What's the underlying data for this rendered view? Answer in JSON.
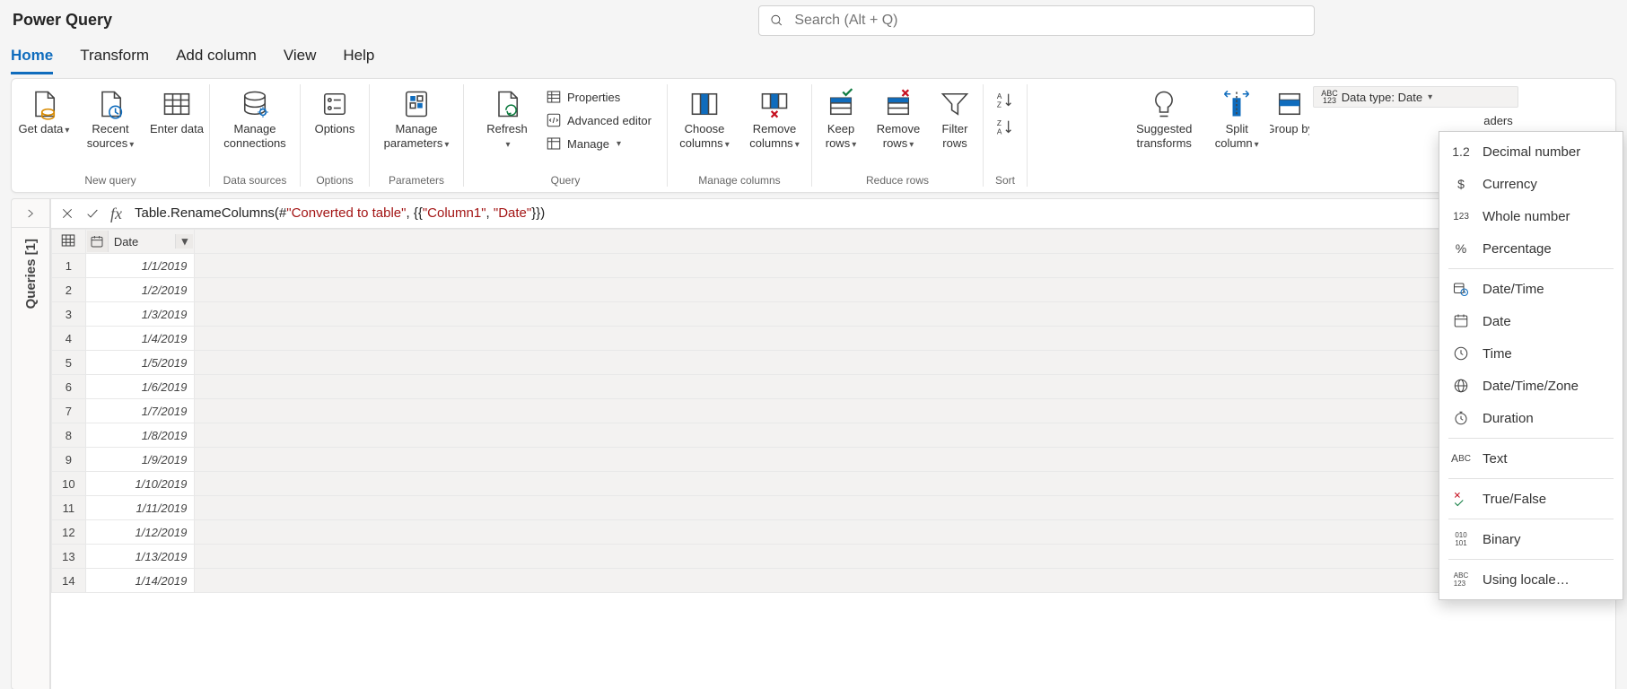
{
  "app_title": "Power Query",
  "search_placeholder": "Search (Alt + Q)",
  "tabs": [
    "Home",
    "Transform",
    "Add column",
    "View",
    "Help"
  ],
  "active_tab": 0,
  "ribbon": {
    "new_query": {
      "label": "New query",
      "get_data": "Get data",
      "recent_sources": "Recent sources",
      "enter_data": "Enter data"
    },
    "data_sources": {
      "label": "Data sources",
      "manage_connections": "Manage connections"
    },
    "options": {
      "label": "Options",
      "options_btn": "Options"
    },
    "parameters": {
      "label": "Parameters",
      "manage_parameters": "Manage parameters"
    },
    "query": {
      "label": "Query",
      "refresh": "Refresh",
      "properties": "Properties",
      "advanced_editor": "Advanced editor",
      "manage": "Manage"
    },
    "manage_columns": {
      "label": "Manage columns",
      "choose": "Choose columns",
      "remove": "Remove columns"
    },
    "reduce_rows": {
      "label": "Reduce rows",
      "keep": "Keep rows",
      "remove": "Remove rows",
      "filter": "Filter rows"
    },
    "sort": {
      "label": "Sort"
    },
    "transform": {
      "suggested": "Suggested transforms",
      "split": "Split column",
      "group": "Group by",
      "data_type": "Data type: Date",
      "headers_fragment": "aders"
    }
  },
  "side_panel_label": "Queries [1]",
  "formula_parts": {
    "p1": "Table.RenameColumns(#",
    "p2": "\"Converted to table\"",
    "p3": ", {{",
    "p4": "\"Column1\"",
    "p5": ", ",
    "p6": "\"Date\"",
    "p7": "}})"
  },
  "column_header": "Date",
  "rows": [
    {
      "n": 1,
      "v": "1/1/2019"
    },
    {
      "n": 2,
      "v": "1/2/2019"
    },
    {
      "n": 3,
      "v": "1/3/2019"
    },
    {
      "n": 4,
      "v": "1/4/2019"
    },
    {
      "n": 5,
      "v": "1/5/2019"
    },
    {
      "n": 6,
      "v": "1/6/2019"
    },
    {
      "n": 7,
      "v": "1/7/2019"
    },
    {
      "n": 8,
      "v": "1/8/2019"
    },
    {
      "n": 9,
      "v": "1/9/2019"
    },
    {
      "n": 10,
      "v": "1/10/2019"
    },
    {
      "n": 11,
      "v": "1/11/2019"
    },
    {
      "n": 12,
      "v": "1/12/2019"
    },
    {
      "n": 13,
      "v": "1/13/2019"
    },
    {
      "n": 14,
      "v": "1/14/2019"
    }
  ],
  "data_type_menu": {
    "decimal": "Decimal number",
    "currency": "Currency",
    "whole": "Whole number",
    "percentage": "Percentage",
    "datetime": "Date/Time",
    "date": "Date",
    "time": "Time",
    "dtz": "Date/Time/Zone",
    "duration": "Duration",
    "text": "Text",
    "tf": "True/False",
    "binary": "Binary",
    "locale": "Using locale…"
  },
  "icon_text": {
    "abc123": "ABC 123",
    "num12": "1.2",
    "num123sub": "1²₃",
    "abc": "Aᴮc",
    "bin": "010 101"
  }
}
